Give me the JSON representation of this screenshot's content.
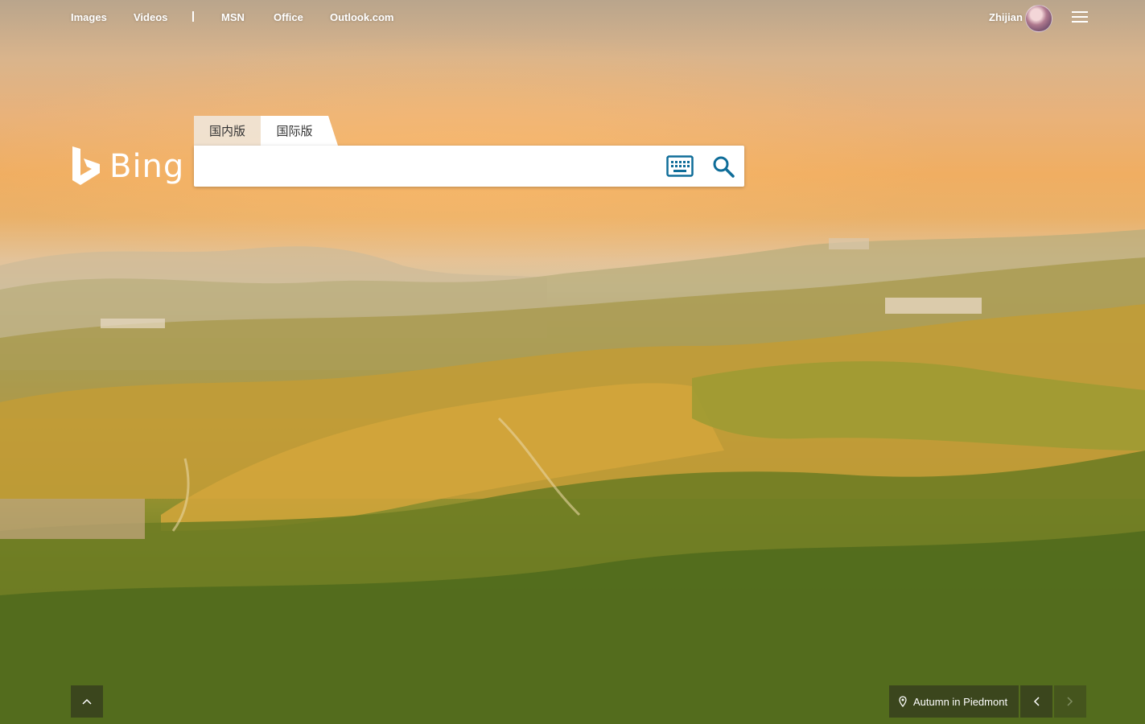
{
  "nav": {
    "items": [
      {
        "label": "Images"
      },
      {
        "label": "Videos"
      },
      {
        "label": "MSN"
      },
      {
        "label": "Office"
      },
      {
        "label": "Outlook.com"
      }
    ]
  },
  "user": {
    "name": "Zhijian"
  },
  "logo": {
    "text": "Bing"
  },
  "search": {
    "tabs": [
      {
        "label": "国内版",
        "selected": false
      },
      {
        "label": "国际版",
        "selected": true
      }
    ],
    "value": "",
    "placeholder": "",
    "accent_color": "#007daa"
  },
  "footer": {
    "caption": "Autumn in Piedmont"
  },
  "icons": {
    "menu": "hamburger-icon",
    "keyboard": "keyboard-icon",
    "search": "search-icon",
    "scroll_up": "chevron-up-icon",
    "location": "location-pin-icon",
    "prev": "chevron-left-icon",
    "next": "chevron-right-icon"
  }
}
